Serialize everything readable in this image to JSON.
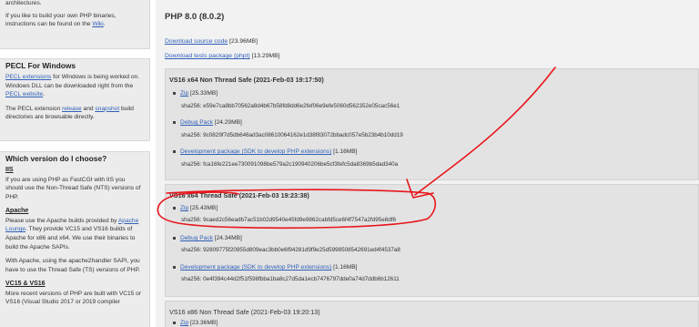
{
  "sidebar": {
    "intro": {
      "line1": "architectures.",
      "text": "If you like to build your own PHP binaries, instructions can be found on the ",
      "wiki_link": "Wiki",
      "tail": "."
    },
    "pecl": {
      "title": "PECL For Windows",
      "ext_link": "PECL extensions",
      "text1": " for Windows is being worked on. Windows DLL can be downloaded right from the ",
      "site_link": "PECL website",
      "text1_tail": ".",
      "text2a": "The PECL extension ",
      "release_link": "release",
      "text2b": " and ",
      "snapshot_link": "snapshot",
      "text2c": " build directories are browsable directly."
    },
    "which": {
      "title": "Which version do I choose?",
      "iis_heading": "IIS",
      "iis_text": "If you are using PHP as FastCGI with IIS you should use the Non-Thread Safe (NTS) versions of PHP.",
      "apache_heading": "Apache",
      "apache_text1a": "Please use the Apache builds provided by ",
      "apache_lounge_link": "Apache Lounge",
      "apache_text1b": ". They provide VC15 and VS16 builds of Apache for x86 and x64. We use their binaries to build the Apache SAPIs.",
      "apache_text2": "With Apache, using the apache2handler SAPI, you have to use the Thread Safe (TS) versions of PHP.",
      "vc_heading": "VC15 & VS16",
      "vc_text": "More recent versions of PHP are built with VC15 or VS16 (Visual Studio 2017 or 2019 compiler"
    }
  },
  "main": {
    "release_title": "PHP 8.0 (8.0.2)",
    "download_source": {
      "label": "Download source code",
      "size": "[23.96MB]"
    },
    "download_tests": {
      "label": "Download tests package (phpt)",
      "size": "[13.29MB]"
    },
    "builds": [
      {
        "title": "VS16 x64 Non Thread Safe (2021-Feb-03 19:17:50)",
        "items": [
          {
            "label": "Zip",
            "size": "[25.33MB]",
            "hash": "sha256: e59e7ca8bb70562a8d4b67b58fd8dd6e2fef06e9efe5060d562352e05cac56e1"
          },
          {
            "label": "Debug Pack",
            "size": "[24.29MB]",
            "hash": "sha256: 9c0829f7d5db646ad3ac08610064162e1d38f83072bbadc057e5b23b4b10dd19"
          },
          {
            "label": "Development package (SDK to develop PHP extensions)",
            "size": "[1.16MB]",
            "hash": "sha256: fca16fe221ee730091098be579a2c190940206be5cf3fefc5da8369b5dad340a"
          }
        ]
      },
      {
        "title": "VS16 x64 Thread Safe (2021-Feb-03 19:23:38)",
        "items": [
          {
            "label": "Zip",
            "size": "[25.43MB]",
            "hash": "sha256: 9caed2c56eadb7ac51b02d9540e45fd9e9862cabfd5ce6f4f7547a2fd95e8df6"
          },
          {
            "label": "Debug Pack",
            "size": "[24.34MB]",
            "hash": "sha256: 92809775f20955d809eac3bb0e6f94281d9f9e25d5998508542691ed4f4537a8"
          },
          {
            "label": "Development package (SDK to develop PHP extensions)",
            "size": "[1.16MB]",
            "hash": "sha256: 0e4f394c44d2f51f598fbba1ba8c27d5da1ecb7476797dde0a74d7ddb6b12611"
          }
        ]
      },
      {
        "title": "VS16 x86 Non Thread Safe (2021-Feb-03 19:20:13)",
        "items": [
          {
            "label": "Zip",
            "size": "[23.36MB]"
          }
        ]
      }
    ]
  },
  "colors": {
    "link": "#3060b8",
    "annotation": "#e8151b",
    "panel": "#f2f2f2",
    "box": "#e3e3e3"
  }
}
